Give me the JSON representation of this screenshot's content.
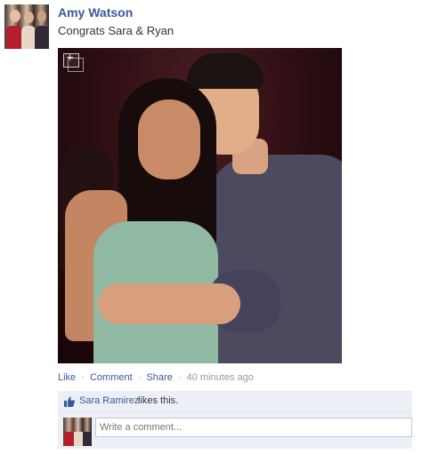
{
  "post": {
    "author": "Amy Watson",
    "message": "Congrats Sara & Ryan",
    "photo_icon": "expand-photo-icon"
  },
  "actions": {
    "like": "Like",
    "comment": "Comment",
    "share": "Share",
    "separator": "·",
    "timestamp": "40 minutes ago"
  },
  "likes": {
    "icon": "thumbs-up-icon",
    "liker": "Sara Ramirez",
    "text": "likes this."
  },
  "comment": {
    "placeholder": "Write a comment..."
  },
  "colors": {
    "link": "#3b5998",
    "muted": "#999999",
    "box_bg": "#eceff5"
  }
}
